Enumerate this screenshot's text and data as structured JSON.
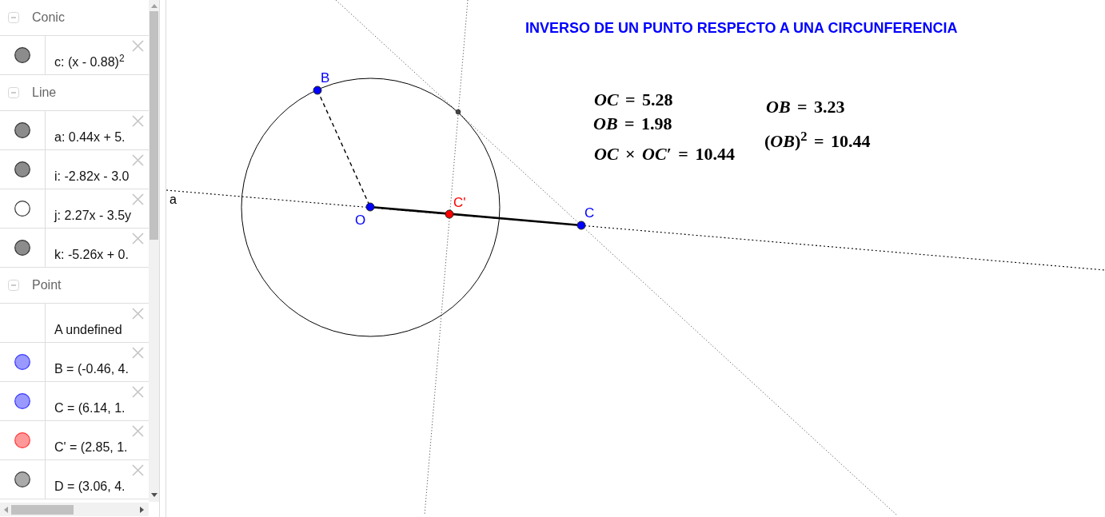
{
  "algebra_view": {
    "groups": [
      {
        "title": "Conic",
        "expanded": true,
        "items": [
          {
            "kind": "value",
            "text": "c: (x - 0.88)$^{2}$",
            "visible": true,
            "color": "#8c8c8c"
          }
        ]
      },
      {
        "title": "Line",
        "expanded": true,
        "items": [
          {
            "kind": "value",
            "text": "a: 0.44x + 5.",
            "visible": true,
            "color": "#8c8c8c"
          },
          {
            "kind": "value",
            "text": "i: -2.82x - 3.0",
            "visible": true,
            "color": "#8c8c8c"
          },
          {
            "kind": "value",
            "text": "j: 2.27x - 3.5y",
            "visible": false
          },
          {
            "kind": "value",
            "text": "k: -5.26x + 0.",
            "visible": true,
            "color": "#8c8c8c"
          }
        ]
      },
      {
        "title": "Point",
        "expanded": true,
        "items": [
          {
            "kind": "undefined",
            "text": "A undefined"
          },
          {
            "kind": "value",
            "text": "B = (-0.46, 4.",
            "visible": true,
            "color": "#9999ff"
          },
          {
            "kind": "value",
            "text": "C = (6.14, 1.",
            "visible": true,
            "color": "#9999ff"
          },
          {
            "kind": "value",
            "text": "C' = (2.85, 1.",
            "visible": true,
            "color": "#ff9999"
          },
          {
            "kind": "value",
            "text": "D = (3.06, 4.",
            "visible": true,
            "color": "#aaaaaa"
          }
        ]
      }
    ]
  },
  "canvas": {
    "title": "INVERSO DE UN PUNTO RESPECTO A UNA CIRCUNFERENCIA",
    "formulas": [
      "*OC* = 5.28",
      "*OB* = 1.98",
      "*OC* × *OC*′ = 10.44",
      "*OB* = 3.23",
      "(*OB*)$^{2}$ = 10.44"
    ],
    "points": [
      {
        "label": "B",
        "color": "#0000ff"
      },
      {
        "label": "O",
        "color": "#0000ff"
      },
      {
        "label": "C'",
        "color": "#ff0000"
      },
      {
        "label": "C",
        "color": "#0000ff"
      },
      {
        "color": "#444444"
      }
    ],
    "line_labels": [
      "a"
    ]
  }
}
